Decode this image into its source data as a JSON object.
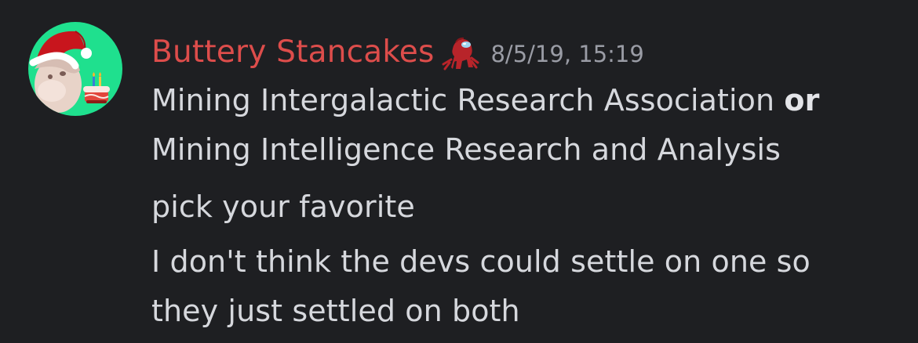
{
  "message": {
    "author": {
      "name": "Buttery Stancakes",
      "name_color": "#dd4d4b",
      "role_icon": "red-crewmate-icon",
      "avatar": {
        "background": "#1fe08e",
        "description_icon": "santa-hat-cat-avatar-icon"
      }
    },
    "timestamp": "8/5/19, 15:19",
    "lines": {
      "line1_text": "Mining Intergalactic Research Association ",
      "line1_bold": "or",
      "line2": "Mining Intelligence Research and Analysis",
      "line3": "pick your favorite",
      "line4": "I don't think the devs could settle on one so",
      "line5": "they just settled on both"
    }
  }
}
